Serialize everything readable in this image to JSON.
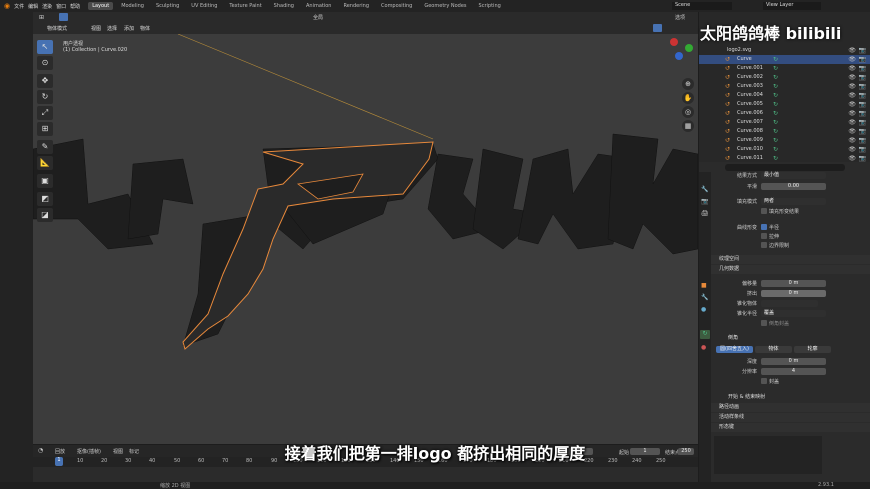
{
  "app": {
    "menus": [
      "文件",
      "编辑",
      "渲染",
      "窗口",
      "帮助"
    ],
    "workspaces": [
      "Layout",
      "Modeling",
      "Sculpting",
      "UV Editing",
      "Texture Paint",
      "Shading",
      "Animation",
      "Rendering",
      "Compositing",
      "Geometry Nodes",
      "Scripting"
    ],
    "active_workspace": "Layout",
    "scene": "Scene",
    "view_layer": "View Layer"
  },
  "viewport": {
    "mode": "物体模式",
    "menus": [
      "视图",
      "选择",
      "添加",
      "物体"
    ],
    "orientation": "全局",
    "options": "选项",
    "info_line1": "用户透视",
    "info_line2": "(1) Collection | Curve.020",
    "logo_text": "RPUNK"
  },
  "outliner": {
    "root": "logo2.svg",
    "items": [
      "Curve",
      "Curve.001",
      "Curve.002",
      "Curve.003",
      "Curve.004",
      "Curve.005",
      "Curve.006",
      "Curve.007",
      "Curve.008",
      "Curve.009",
      "Curve.010",
      "Curve.011"
    ]
  },
  "properties": {
    "fill_method_label": "结果方式",
    "fill_method_value": "最小值",
    "offset_label": "平滑",
    "offset_value": "0.00",
    "fill_mode_label": "填充模式",
    "fill_mode_value": "两者",
    "fill_deform": "填充形变结果",
    "curve_deform_label": "曲线形变",
    "radius": "半径",
    "stretch": "拉伸",
    "bounds_clamp": "边界限制",
    "texture_space": "纹理空间",
    "geometry": "几何数据",
    "offset2_label": "偏移量",
    "offset2_value": "0 m",
    "extrude_label": "挤出",
    "extrude_value": "0 m",
    "taper_label": "锥化物体",
    "taper_radius_label": "锥化半径",
    "taper_radius_value": "覆盖",
    "fill_caps": "倒角封盖",
    "bevel": "倒角",
    "bevel_tabs": [
      "圆(四舍五入)",
      "物体",
      "轮廓"
    ],
    "depth_label": "深度",
    "depth_value": "0 m",
    "resolution_label": "分辨率",
    "resolution_value": "4",
    "fill_caps2": "封盖",
    "start_end": "开始 & 结束映射",
    "path_anim": "路径动画",
    "active_spline": "活动样条线",
    "shape_keys": "形态键"
  },
  "timeline": {
    "menus": [
      "回放",
      "抠像(插帧)",
      "视图",
      "标记"
    ],
    "current_frame": "1",
    "start_label": "起始",
    "start_value": "1",
    "end_label": "结束点",
    "end_value": "250",
    "ticks": [
      "1",
      "10",
      "20",
      "30",
      "40",
      "50",
      "60",
      "70",
      "80",
      "90",
      "100",
      "110",
      "120",
      "130",
      "140",
      "150",
      "160",
      "170",
      "180",
      "190",
      "200",
      "210",
      "220",
      "230",
      "240",
      "250"
    ]
  },
  "status": {
    "hint": "缩放 2D 视图",
    "version": "2.93.1"
  },
  "subtitle": "接着我们把第一排logo 都挤出相同的厚度",
  "watermark": "太阳鸽鸽棒 bilibili"
}
